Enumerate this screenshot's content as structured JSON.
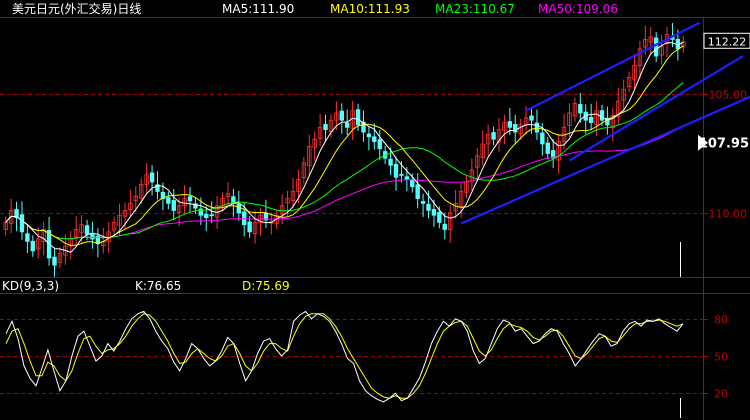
{
  "header": {
    "title": "美元日元(外汇交易)日线",
    "ma": [
      {
        "label": "MA5:111.90",
        "color": "#ffffff"
      },
      {
        "label": "MA10:111.93",
        "color": "#ffff00"
      },
      {
        "label": "MA23:110.67",
        "color": "#00ff00"
      },
      {
        "label": "MA50:109.06",
        "color": "#ff00ff"
      }
    ]
  },
  "price_axis": {
    "ticks": [
      "110.00",
      "105.00"
    ],
    "last_price": "112.22",
    "marker_price": "107.95"
  },
  "kd": {
    "label": "KD(9,3,3)",
    "k_label": "K:76.65",
    "d_label": "D:75.69",
    "ticks": [
      "80",
      "50",
      "20"
    ]
  },
  "colors": {
    "up": "#ff3232",
    "down": "#54ffff",
    "ma5": "#ffffff",
    "ma10": "#ffff00",
    "ma23": "#00ff00",
    "ma50": "#ff00ff",
    "trend": "#1e1eff",
    "grid": "#a00000",
    "axis": "#c00000"
  },
  "chart_data": {
    "type": "candlestick",
    "ylim": [
      102.3,
      113.2
    ],
    "kd_ylim": [
      0,
      100
    ],
    "price_ticks": [
      105,
      110
    ],
    "kd_ticks": [
      20,
      50,
      80
    ],
    "close": [
      104.6,
      105.1,
      104.8,
      104.2,
      103.8,
      103.4,
      103.9,
      104.3,
      103.1,
      102.8,
      103.3,
      103.6,
      103.9,
      104.3,
      104.5,
      104.1,
      103.9,
      103.7,
      103.8,
      104.2,
      104.6,
      104.9,
      105.1,
      105.4,
      105.7,
      106.2,
      106.6,
      106.3,
      105.9,
      105.6,
      105.4,
      105.1,
      105.3,
      105.6,
      105.5,
      105.2,
      104.9,
      104.8,
      104.9,
      105.3,
      105.6,
      105.8,
      105.4,
      105.0,
      104.5,
      104.2,
      104.6,
      104.9,
      104.7,
      104.6,
      104.9,
      105.3,
      105.6,
      105.9,
      106.4,
      107.1,
      107.8,
      108.1,
      108.6,
      108.5,
      108.9,
      109.2,
      108.9,
      108.6,
      109.3,
      108.7,
      108.4,
      108.2,
      108.0,
      107.7,
      107.3,
      107.0,
      106.5,
      106.6,
      106.4,
      106.1,
      105.6,
      105.4,
      105.1,
      104.9,
      104.6,
      104.3,
      105.0,
      105.4,
      105.9,
      106.3,
      106.8,
      107.4,
      107.9,
      108.3,
      108.1,
      108.5,
      108.8,
      108.6,
      108.4,
      108.7,
      109.0,
      108.9,
      108.4,
      107.9,
      107.5,
      107.3,
      108.0,
      108.6,
      109.2,
      109.6,
      109.2,
      108.9,
      108.8,
      109.3,
      108.9,
      108.7,
      109.1,
      109.7,
      110.2,
      110.7,
      111.2,
      111.9,
      112.3,
      112.4,
      111.6,
      112.0,
      112.5,
      112.3,
      111.9,
      112.2
    ]
  },
  "kd_data": {
    "k": [
      68,
      78,
      64,
      42,
      32,
      26,
      40,
      55,
      38,
      22,
      30,
      50,
      66,
      70,
      58,
      46,
      50,
      60,
      54,
      62,
      72,
      80,
      84,
      86,
      80,
      70,
      62,
      56,
      45,
      38,
      48,
      60,
      56,
      48,
      42,
      46,
      54,
      65,
      60,
      44,
      30,
      38,
      52,
      62,
      64,
      56,
      50,
      55,
      78,
      83,
      86,
      80,
      84,
      82,
      78,
      70,
      60,
      48,
      44,
      30,
      22,
      18,
      15,
      13,
      16,
      20,
      14,
      16,
      24,
      32,
      45,
      60,
      70,
      78,
      74,
      80,
      78,
      70,
      54,
      44,
      48,
      60,
      72,
      79,
      77,
      70,
      72,
      66,
      60,
      62,
      68,
      72,
      70,
      60,
      52,
      42,
      48,
      55,
      62,
      68,
      66,
      58,
      60,
      70,
      76,
      78,
      74,
      79,
      78,
      80,
      76,
      73,
      70,
      76
    ],
    "d": [
      60,
      70,
      72,
      60,
      46,
      34,
      34,
      45,
      42,
      34,
      30,
      38,
      52,
      64,
      66,
      58,
      52,
      55,
      56,
      60,
      66,
      74,
      80,
      84,
      83,
      78,
      70,
      62,
      52,
      44,
      45,
      52,
      56,
      52,
      48,
      46,
      50,
      58,
      60,
      52,
      42,
      38,
      44,
      54,
      60,
      60,
      56,
      54,
      66,
      76,
      82,
      84,
      84,
      84,
      80,
      74,
      66,
      56,
      48,
      40,
      32,
      24,
      20,
      17,
      16,
      18,
      16,
      16,
      20,
      26,
      36,
      48,
      60,
      70,
      74,
      77,
      78,
      74,
      64,
      54,
      50,
      55,
      64,
      72,
      76,
      74,
      73,
      70,
      65,
      63,
      66,
      70,
      71,
      66,
      58,
      50,
      48,
      52,
      58,
      64,
      66,
      62,
      61,
      66,
      72,
      76,
      76,
      78,
      78,
      79,
      78,
      76,
      74,
      76
    ]
  }
}
